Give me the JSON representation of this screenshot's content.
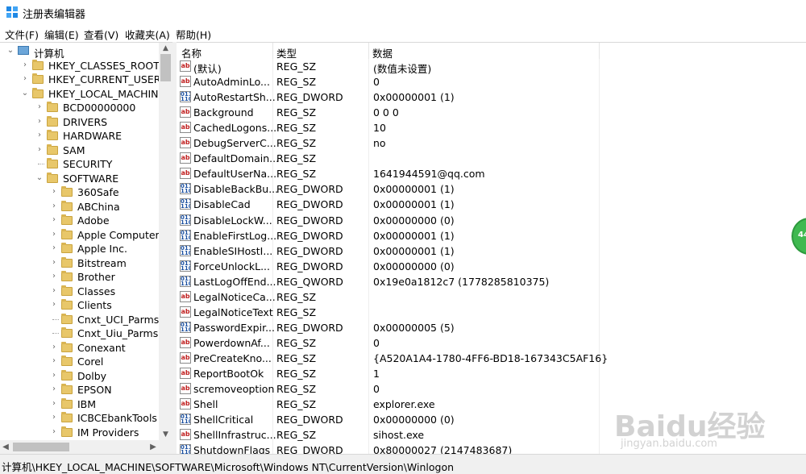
{
  "window": {
    "title": "注册表编辑器"
  },
  "menu": [
    "文件(F)",
    "编辑(E)",
    "查看(V)",
    "收藏夹(A)",
    "帮助(H)"
  ],
  "tree": [
    {
      "label": "计算机",
      "arrow": "open",
      "level": 0,
      "type": "computer"
    },
    {
      "label": "HKEY_CLASSES_ROOT",
      "arrow": "closed",
      "level": 1
    },
    {
      "label": "HKEY_CURRENT_USER",
      "arrow": "closed",
      "level": 1
    },
    {
      "label": "HKEY_LOCAL_MACHINE",
      "arrow": "open",
      "level": 1
    },
    {
      "label": "BCD00000000",
      "arrow": "closed",
      "level": 2
    },
    {
      "label": "DRIVERS",
      "arrow": "closed",
      "level": 2
    },
    {
      "label": "HARDWARE",
      "arrow": "closed",
      "level": 2
    },
    {
      "label": "SAM",
      "arrow": "closed",
      "level": 2
    },
    {
      "label": "SECURITY",
      "arrow": "none",
      "level": 2
    },
    {
      "label": "SOFTWARE",
      "arrow": "open",
      "level": 2
    },
    {
      "label": "360Safe",
      "arrow": "closed",
      "level": 3
    },
    {
      "label": "ABChina",
      "arrow": "closed",
      "level": 3
    },
    {
      "label": "Adobe",
      "arrow": "closed",
      "level": 3
    },
    {
      "label": "Apple Computer,",
      "arrow": "closed",
      "level": 3
    },
    {
      "label": "Apple Inc.",
      "arrow": "closed",
      "level": 3
    },
    {
      "label": "Bitstream",
      "arrow": "closed",
      "level": 3
    },
    {
      "label": "Brother",
      "arrow": "closed",
      "level": 3
    },
    {
      "label": "Classes",
      "arrow": "closed",
      "level": 3
    },
    {
      "label": "Clients",
      "arrow": "closed",
      "level": 3
    },
    {
      "label": "Cnxt_UCI_Parms",
      "arrow": "none",
      "level": 3
    },
    {
      "label": "Cnxt_Uiu_Parms",
      "arrow": "none",
      "level": 3
    },
    {
      "label": "Conexant",
      "arrow": "closed",
      "level": 3
    },
    {
      "label": "Corel",
      "arrow": "closed",
      "level": 3
    },
    {
      "label": "Dolby",
      "arrow": "closed",
      "level": 3
    },
    {
      "label": "EPSON",
      "arrow": "closed",
      "level": 3
    },
    {
      "label": "IBM",
      "arrow": "closed",
      "level": 3
    },
    {
      "label": "ICBCEbankTools",
      "arrow": "closed",
      "level": 3
    },
    {
      "label": "IM Providers",
      "arrow": "closed",
      "level": 3
    },
    {
      "label": "",
      "arrow": "none",
      "level": 3
    }
  ],
  "list": {
    "headers": {
      "name": "名称",
      "type": "类型",
      "data": "数据"
    },
    "rows": [
      {
        "icon": "ab",
        "name": "(默认)",
        "type": "REG_SZ",
        "data": "(数值未设置)"
      },
      {
        "icon": "ab",
        "name": "AutoAdminLo...",
        "type": "REG_SZ",
        "data": "0"
      },
      {
        "icon": "bin",
        "name": "AutoRestartSh...",
        "type": "REG_DWORD",
        "data": "0x00000001 (1)"
      },
      {
        "icon": "ab",
        "name": "Background",
        "type": "REG_SZ",
        "data": "0 0 0"
      },
      {
        "icon": "ab",
        "name": "CachedLogons...",
        "type": "REG_SZ",
        "data": "10"
      },
      {
        "icon": "ab",
        "name": "DebugServerC...",
        "type": "REG_SZ",
        "data": "no"
      },
      {
        "icon": "ab",
        "name": "DefaultDomain...",
        "type": "REG_SZ",
        "data": ""
      },
      {
        "icon": "ab",
        "name": "DefaultUserNa...",
        "type": "REG_SZ",
        "data": "1641944591@qq.com"
      },
      {
        "icon": "bin",
        "name": "DisableBackBu...",
        "type": "REG_DWORD",
        "data": "0x00000001 (1)"
      },
      {
        "icon": "bin",
        "name": "DisableCad",
        "type": "REG_DWORD",
        "data": "0x00000001 (1)"
      },
      {
        "icon": "bin",
        "name": "DisableLockW...",
        "type": "REG_DWORD",
        "data": "0x00000000 (0)"
      },
      {
        "icon": "bin",
        "name": "EnableFirstLog...",
        "type": "REG_DWORD",
        "data": "0x00000001 (1)"
      },
      {
        "icon": "bin",
        "name": "EnableSIHostI...",
        "type": "REG_DWORD",
        "data": "0x00000001 (1)"
      },
      {
        "icon": "bin",
        "name": "ForceUnlockL...",
        "type": "REG_DWORD",
        "data": "0x00000000 (0)"
      },
      {
        "icon": "bin",
        "name": "LastLogOffEnd...",
        "type": "REG_QWORD",
        "data": "0x19e0a1812c7 (1778285810375)"
      },
      {
        "icon": "ab",
        "name": "LegalNoticeCa...",
        "type": "REG_SZ",
        "data": ""
      },
      {
        "icon": "ab",
        "name": "LegalNoticeText",
        "type": "REG_SZ",
        "data": ""
      },
      {
        "icon": "bin",
        "name": "PasswordExpir...",
        "type": "REG_DWORD",
        "data": "0x00000005 (5)"
      },
      {
        "icon": "ab",
        "name": "PowerdownAf...",
        "type": "REG_SZ",
        "data": "0"
      },
      {
        "icon": "ab",
        "name": "PreCreateKno...",
        "type": "REG_SZ",
        "data": "{A520A1A4-1780-4FF6-BD18-167343C5AF16}"
      },
      {
        "icon": "ab",
        "name": "ReportBootOk",
        "type": "REG_SZ",
        "data": "1"
      },
      {
        "icon": "ab",
        "name": "scremoveoption",
        "type": "REG_SZ",
        "data": "0"
      },
      {
        "icon": "ab",
        "name": "Shell",
        "type": "REG_SZ",
        "data": "explorer.exe"
      },
      {
        "icon": "bin",
        "name": "ShellCritical",
        "type": "REG_DWORD",
        "data": "0x00000000 (0)"
      },
      {
        "icon": "ab",
        "name": "ShellInfrastruc...",
        "type": "REG_SZ",
        "data": "sihost.exe"
      },
      {
        "icon": "bin",
        "name": "ShutdownFlags",
        "type": "REG_DWORD",
        "data": "0x80000027 (2147483687)"
      }
    ]
  },
  "status": {
    "path": "计算机\\HKEY_LOCAL_MACHINE\\SOFTWARE\\Microsoft\\Windows NT\\CurrentVersion\\Winlogon"
  },
  "overlay": {
    "badge": "44",
    "watermark": "Baidu经验",
    "watermark_sub": "jingyan.baidu.com"
  }
}
